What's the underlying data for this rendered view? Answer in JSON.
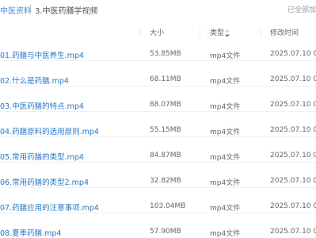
{
  "breadcrumb": {
    "root": "中医资料",
    "separator": "/",
    "current": "3.中医药膳学视频"
  },
  "status": {
    "loaded": "已全部加"
  },
  "table": {
    "columns": {
      "size": "大小",
      "type": "类型",
      "modified": "修改时间"
    },
    "sort_icon": "sort-arrows-icon",
    "rows": [
      {
        "name": "01.药膳与中医养生.mp4",
        "size": "53.85MB",
        "type": "mp4文件",
        "modified": "2025.07.10 06:0"
      },
      {
        "name": "02.什么是药膳.mp4",
        "size": "68.11MB",
        "type": "mp4文件",
        "modified": "2025.07.10 06:0"
      },
      {
        "name": "03.中医药膳的特点.mp4",
        "size": "88.07MB",
        "type": "mp4文件",
        "modified": "2025.07.10 06:0"
      },
      {
        "name": "04.药膳原料的选用原则.mp4",
        "size": "55.15MB",
        "type": "mp4文件",
        "modified": "2025.07.10 06:0"
      },
      {
        "name": "05.常用药膳的类型.mp4",
        "size": "84.87MB",
        "type": "mp4文件",
        "modified": "2025.07.10 06:0"
      },
      {
        "name": "06.常用药膳的类型2.mp4",
        "size": "32.82MB",
        "type": "mp4文件",
        "modified": "2025.07.10 06:0"
      },
      {
        "name": "07.药膳应用的注意事项.mp4",
        "size": "103.04MB",
        "type": "mp4文件",
        "modified": "2025.07.10 06:0"
      },
      {
        "name": "08.夏季药膳.mp4",
        "size": "57.90MB",
        "type": "mp4文件",
        "modified": "2025.07.10 06:0"
      }
    ]
  },
  "colors": {
    "link": "#2a78c7",
    "breadcrumb_link": "#4a8fd6",
    "sort_active": "#4a8fd6",
    "muted_text": "#666666"
  }
}
